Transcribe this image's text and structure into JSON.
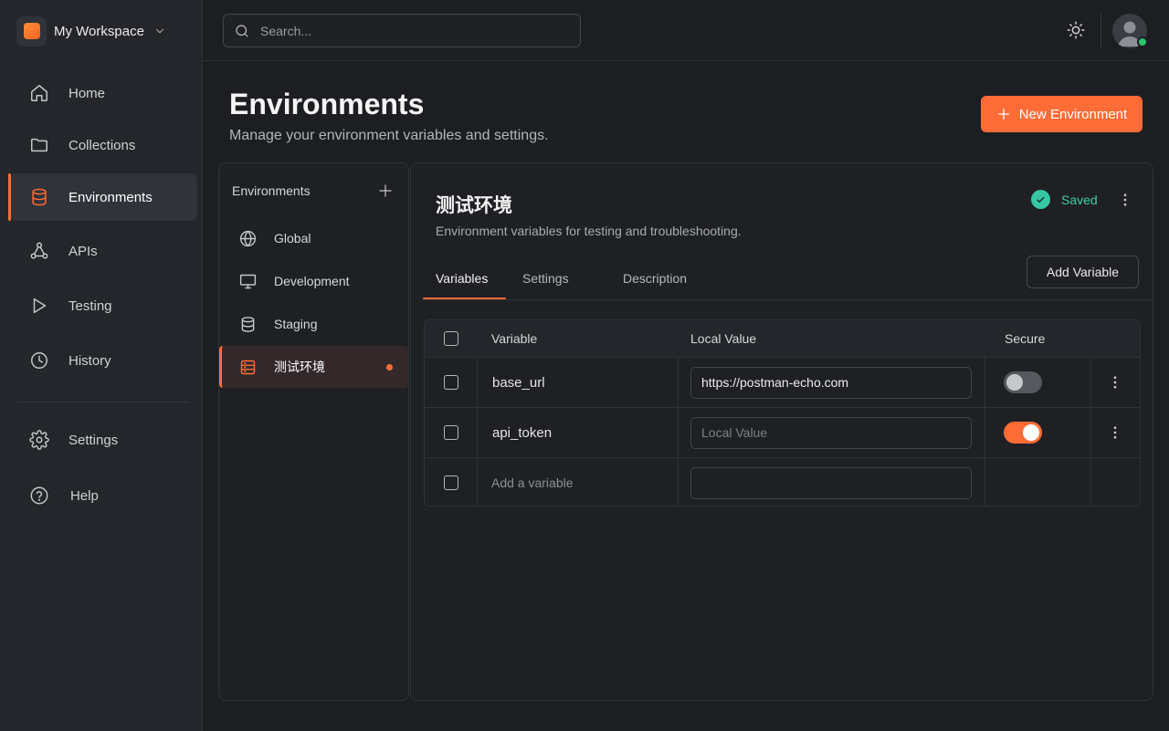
{
  "workspace": {
    "name": "My Workspace"
  },
  "search": {
    "placeholder": "Search..."
  },
  "nav": {
    "items": [
      {
        "label": "Home"
      },
      {
        "label": "Collections"
      },
      {
        "label": "Environments"
      },
      {
        "label": "APIs"
      },
      {
        "label": "Testing"
      },
      {
        "label": "History"
      }
    ],
    "bottom": [
      {
        "label": "Settings"
      },
      {
        "label": "Help"
      }
    ]
  },
  "page": {
    "title": "Environments",
    "subtitle": "Manage your environment variables and settings.",
    "new_button": "New Environment"
  },
  "env_list": {
    "header": "Environments",
    "items": [
      {
        "label": "Global"
      },
      {
        "label": "Development"
      },
      {
        "label": "Staging"
      },
      {
        "label": "测试环境"
      }
    ]
  },
  "env_detail": {
    "title": "测试环境",
    "description": "Environment variables for testing and troubleshooting.",
    "status": "Saved",
    "tabs": [
      "Variables",
      "Settings",
      "Description"
    ],
    "add_variable": "Add Variable"
  },
  "table": {
    "headers": {
      "variable": "Variable",
      "local_value": "Local Value",
      "secure": "Secure"
    },
    "rows": [
      {
        "variable": "base_url",
        "value": "https://postman-echo.com",
        "placeholder": "",
        "secure": false
      },
      {
        "variable": "api_token",
        "value": "",
        "placeholder": "Local Value",
        "secure": true
      }
    ],
    "new_row_placeholder": "Add a variable"
  },
  "colors": {
    "accent": "#ff6c37",
    "success": "#3ecfa8",
    "online": "#2bc36a"
  }
}
